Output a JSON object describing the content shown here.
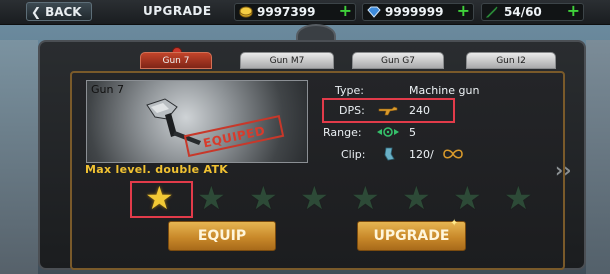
{
  "topbar": {
    "back_label": "BACK",
    "title": "UPGRADE",
    "gold": "9997399",
    "gems": "9999999",
    "ammo": "54/60"
  },
  "tabs": [
    {
      "label": "Gun 7",
      "active": true
    },
    {
      "label": "Gun M7",
      "active": false
    },
    {
      "label": "Gun G7",
      "active": false
    },
    {
      "label": "Gun I2",
      "active": false
    }
  ],
  "gun": {
    "name": "Gun 7",
    "status_stamp": "EQUIPED"
  },
  "stats": {
    "type_label": "Type:",
    "type_value": "Machine gun",
    "dps_label": "DPS:",
    "dps_value": "240",
    "range_label": "Range:",
    "range_value": "5",
    "clip_label": "Clip:",
    "clip_value": "120/"
  },
  "level": {
    "text": "Max level. double ATK",
    "stars_total": 8,
    "stars_filled": 1
  },
  "buttons": {
    "equip": "EQUIP",
    "upgrade": "UPGRADE"
  },
  "icons": {
    "back": "chevron-left-icon",
    "gold": "coin-icon",
    "gems": "gem-icon",
    "ammo": "bullet-icon",
    "add": "plus-icon",
    "dps": "gun-icon",
    "range": "range-icon",
    "clip": "clip-icon",
    "infinity": "infinity-icon",
    "star": "star-icon",
    "next": "double-chevron-right-icon"
  },
  "colors": {
    "accent_gold": "#f1c232",
    "highlight_red": "#e23b4a",
    "plus_green": "#3fd13a",
    "tab_active": "#c2442a"
  }
}
